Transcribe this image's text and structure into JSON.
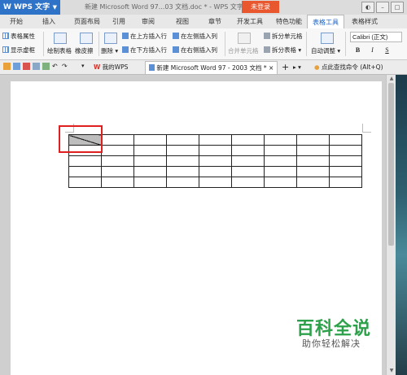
{
  "titlebar": {
    "app_name": "WPS 文字",
    "document_title": "新建 Microsoft Word 97...03 文档.doc * - WPS 文字",
    "login_label": "未登录"
  },
  "ribbon_tabs": [
    "开始",
    "插入",
    "页面布局",
    "引用",
    "审阅",
    "视图",
    "章节",
    "开发工具",
    "特色功能",
    "表格工具",
    "表格样式"
  ],
  "active_tab": "表格工具",
  "ribbon": {
    "table_properties": "表格属性",
    "show_gridlines": "显示虚框",
    "draw_table": "绘制表格",
    "eraser": "橡皮擦",
    "delete": "删除",
    "insert_above": "在上方插入行",
    "insert_below": "在下方插入行",
    "insert_left": "在左侧插入列",
    "insert_right": "在右侧插入列",
    "merge_cells": "合并单元格",
    "split_cells": "拆分单元格",
    "split_table": "拆分表格",
    "autofit": "自动调整",
    "font_name": "Calibri (正文)",
    "bold": "B",
    "italic": "I",
    "underline": "S"
  },
  "quickbar": {
    "tab_mywps": "我的WPS",
    "tab_doc": "新建 Microsoft Word 97 - 2003 文档 *",
    "add_tab": "+",
    "search_hint": "点此查找命令 (Alt+Q)"
  },
  "table": {
    "rows": 5,
    "cols": 9
  },
  "watermark": {
    "title": "百科全说",
    "subtitle": "助你轻松解决"
  },
  "colors": {
    "accent": "#2e73c8",
    "login": "#e8572e",
    "highlight": "#e02020",
    "watermark": "#2da14a"
  }
}
